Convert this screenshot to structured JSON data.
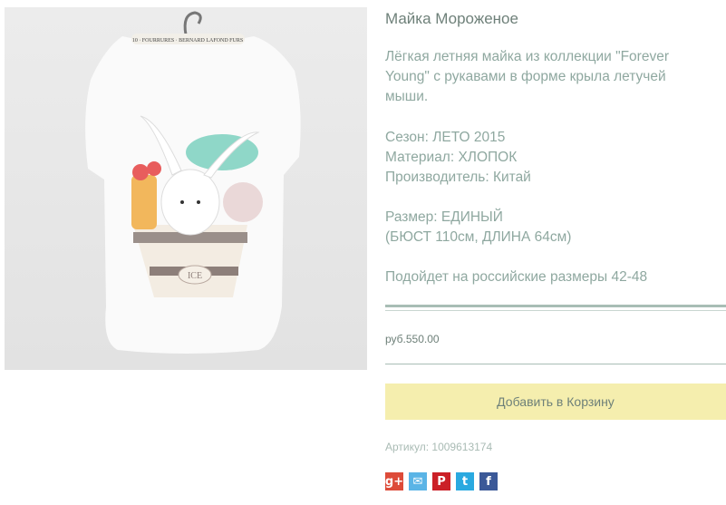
{
  "product": {
    "title": "Майка Мороженое",
    "description": [
      "Лёгкая летняя майка из коллекции \"Forever Young\" с рукавами в форме крыла летучей мыши."
    ],
    "specs": [
      "Сезон: ЛЕТО 2015",
      "Материал: ХЛОПОК",
      "Производитель: Китай"
    ],
    "size": [
      "Размер: ЕДИНЫЙ",
      "(БЮСТ 110см, ДЛИНА 64см)"
    ],
    "fit_note": "Подойдет на российские размеры 42-48",
    "price": "руб.550.00",
    "add_to_cart_label": "Добавить в Корзину",
    "sku": "Артикул: 1009613174"
  },
  "image": {
    "hanger_label": "10 · FOURRURES · BERNARD LAFOND FURS",
    "print_text": "ICE"
  },
  "social": [
    {
      "name": "google-plus-icon",
      "glyph": "g+",
      "color": "#dd4b39"
    },
    {
      "name": "odnoklassniki-icon",
      "glyph": "✉",
      "color": "#5ab4e6"
    },
    {
      "name": "pinterest-icon",
      "glyph": "P",
      "color": "#cb2027"
    },
    {
      "name": "twitter-icon",
      "glyph": "t",
      "color": "#2aa9e0"
    },
    {
      "name": "facebook-icon",
      "glyph": "f",
      "color": "#3b5998"
    }
  ],
  "colors": {
    "text": "#8fa8a0",
    "button": "#f5eeae",
    "rule": "#a8bdb5"
  }
}
